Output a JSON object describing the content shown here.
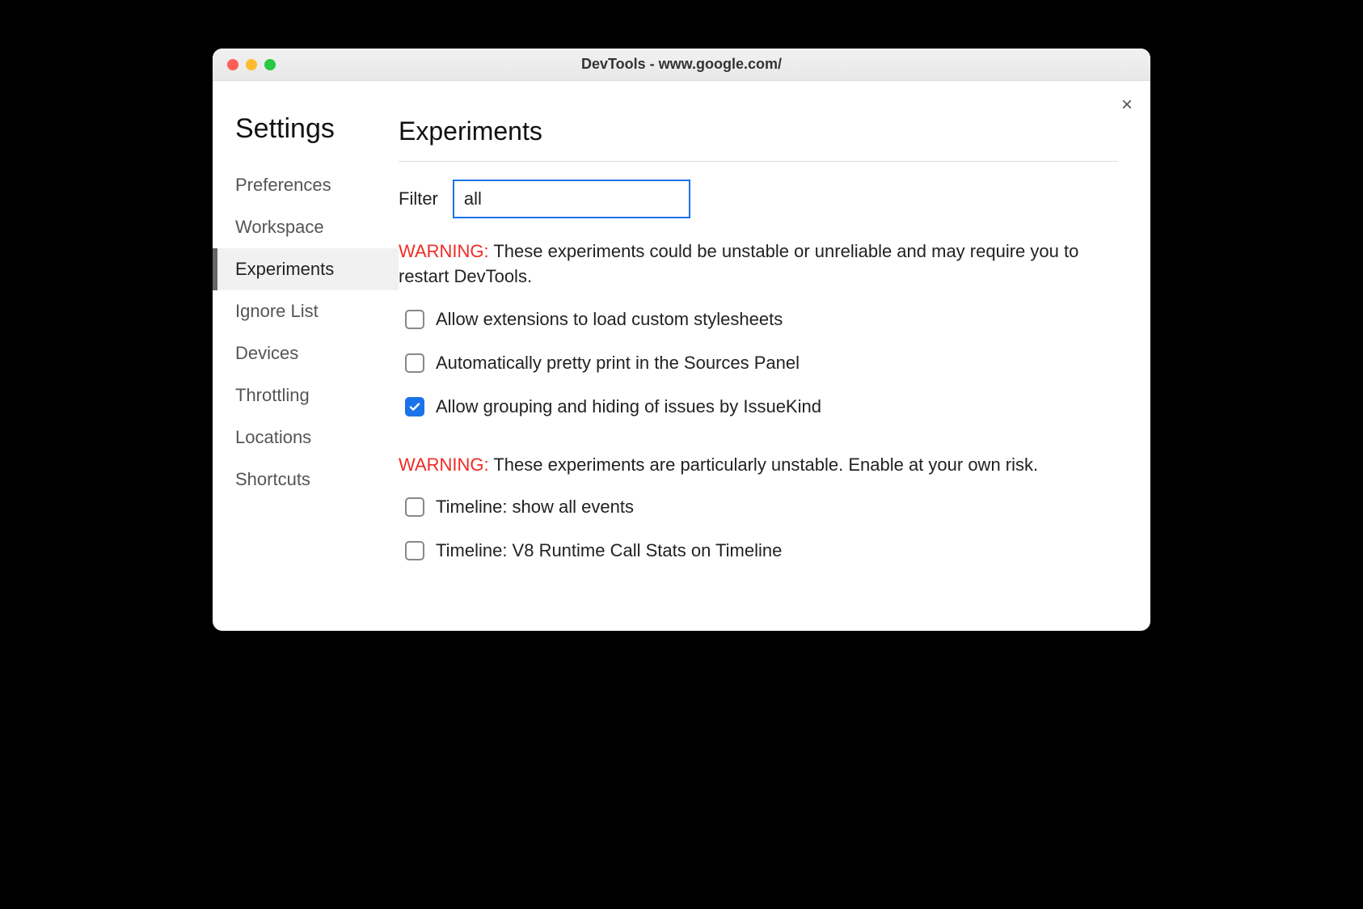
{
  "window": {
    "title": "DevTools - www.google.com/"
  },
  "sidebar": {
    "heading": "Settings",
    "items": [
      {
        "label": "Preferences",
        "selected": false
      },
      {
        "label": "Workspace",
        "selected": false
      },
      {
        "label": "Experiments",
        "selected": true
      },
      {
        "label": "Ignore List",
        "selected": false
      },
      {
        "label": "Devices",
        "selected": false
      },
      {
        "label": "Throttling",
        "selected": false
      },
      {
        "label": "Locations",
        "selected": false
      },
      {
        "label": "Shortcuts",
        "selected": false
      }
    ]
  },
  "main": {
    "heading": "Experiments",
    "filter": {
      "label": "Filter",
      "value": "all"
    },
    "warning1": {
      "label": "WARNING:",
      "text": " These experiments could be unstable or unreliable and may require you to restart DevTools."
    },
    "group1": [
      {
        "label": "Allow extensions to load custom stylesheets",
        "checked": false
      },
      {
        "label": "Automatically pretty print in the Sources Panel",
        "checked": false
      },
      {
        "label": "Allow grouping and hiding of issues by IssueKind",
        "checked": true
      }
    ],
    "warning2": {
      "label": "WARNING:",
      "text": " These experiments are particularly unstable. Enable at your own risk."
    },
    "group2": [
      {
        "label": "Timeline: show all events",
        "checked": false
      },
      {
        "label": "Timeline: V8 Runtime Call Stats on Timeline",
        "checked": false
      }
    ]
  },
  "close_label": "×"
}
